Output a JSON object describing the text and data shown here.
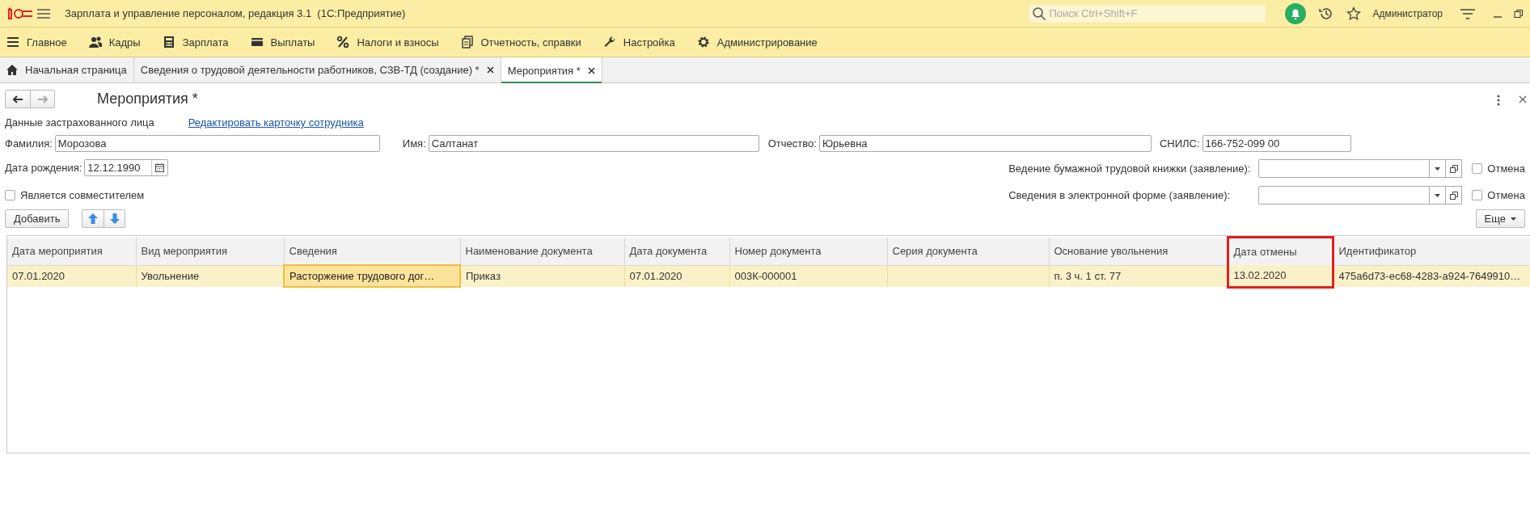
{
  "window": {
    "title": "Зарплата и управление персоналом, редакция 3.1  (1С:Предприятие)",
    "search_placeholder": "Поиск Ctrl+Shift+F",
    "user": "Администратор"
  },
  "menu": [
    {
      "label": "Главное"
    },
    {
      "label": "Кадры"
    },
    {
      "label": "Зарплата"
    },
    {
      "label": "Выплаты"
    },
    {
      "label": "Налоги и взносы"
    },
    {
      "label": "Отчетность, справки"
    },
    {
      "label": "Настройка"
    },
    {
      "label": "Администрирование"
    }
  ],
  "tabs": [
    {
      "label": "Начальная страница",
      "selected": false,
      "closable": false
    },
    {
      "label": "Сведения о трудовой деятельности работников, СЗВ-ТД (создание) *",
      "selected": false,
      "closable": true
    },
    {
      "label": "Мероприятия *",
      "selected": true,
      "closable": true
    }
  ],
  "form": {
    "title": "Мероприятия *",
    "back_enabled": true,
    "forward_enabled": false,
    "section_label": "Данные застрахованного лица",
    "edit_link": "Редактировать карточку сотрудника",
    "fields": [
      {
        "label": "Фамилия:",
        "value": "Морозова"
      },
      {
        "label": "Имя:",
        "value": "Салтанат"
      },
      {
        "label": "Отчество:",
        "value": "Юрьевна"
      },
      {
        "label": "СНИЛС:",
        "value": "166-752-099 00"
      }
    ],
    "birth_date": {
      "label": "Дата рождения:",
      "value": "12.12.1990"
    },
    "part_time": {
      "label": "Является совместителем",
      "checked": false
    },
    "statements": [
      {
        "label": "Ведение бумажной трудовой книжки (заявление):",
        "cancel_label": "Отмена",
        "cancel_checked": false
      },
      {
        "label": "Сведения в электронной форме (заявление):",
        "cancel_label": "Отмена",
        "cancel_checked": false
      }
    ],
    "add_button": "Добавить",
    "more_button": "Еще"
  },
  "table": {
    "columns": [
      {
        "label": "Дата мероприятия",
        "highlighted": false
      },
      {
        "label": "Вид мероприятия",
        "highlighted": false
      },
      {
        "label": "Сведения",
        "highlighted": false
      },
      {
        "label": "Наименование документа",
        "highlighted": false
      },
      {
        "label": "Дата документа",
        "highlighted": false
      },
      {
        "label": "Номер документа",
        "highlighted": false
      },
      {
        "label": "Серия документа",
        "highlighted": false
      },
      {
        "label": "Основание увольнения",
        "highlighted": false
      },
      {
        "label": "Дата отмены",
        "highlighted": true
      },
      {
        "label": "Идентификатор",
        "highlighted": false
      }
    ],
    "rows": [
      {
        "selected": true,
        "cells": [
          {
            "text": "07.01.2020",
            "selected": false
          },
          {
            "text": "Увольнение",
            "selected": false
          },
          {
            "text": "Расторжение трудового дог…",
            "selected": true
          },
          {
            "text": "Приказ",
            "selected": false
          },
          {
            "text": "07.01.2020",
            "selected": false
          },
          {
            "text": "003К-000001",
            "selected": false
          },
          {
            "text": "",
            "selected": false
          },
          {
            "text": "п. 3 ч. 1 ст. 77",
            "selected": false
          },
          {
            "text": "13.02.2020",
            "selected": false
          },
          {
            "text": "475a6d73-ec68-4283-a924-7649910…",
            "selected": false
          }
        ]
      }
    ]
  }
}
